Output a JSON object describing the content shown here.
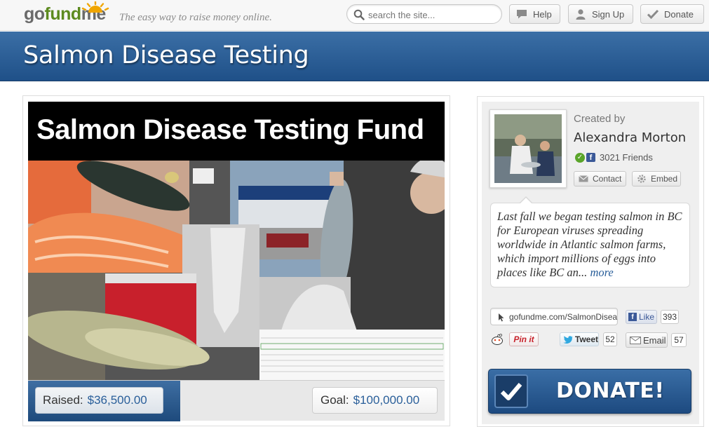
{
  "header": {
    "logo_text": "gofundme",
    "tagline": "The easy way to raise money online.",
    "search_placeholder": "search the site...",
    "help_label": "Help",
    "signup_label": "Sign Up",
    "donate_label": "Donate"
  },
  "campaign": {
    "title": "Salmon Disease Testing",
    "photo_title": "Salmon Disease Testing Fund",
    "raised_label": "Raised:",
    "raised_amount": "$36,500.00",
    "goal_label": "Goal:",
    "goal_amount": "$100,000.00",
    "progress_fraction": 0.365
  },
  "creator": {
    "created_by_label": "Created by",
    "name": "Alexandra Morton",
    "friends": "3021 Friends",
    "contact_label": "Contact",
    "embed_label": "Embed"
  },
  "description": {
    "text": "Last fall we began testing salmon in BC for European viruses spreading worldwide in Atlantic salmon farms, which import millions of eggs into places like BC an...",
    "more_label": "more"
  },
  "share": {
    "url": "gofundme.com/SalmonDisease",
    "like_label": "Like",
    "like_count": "393",
    "pinit_label": "Pin it",
    "tweet_label": "Tweet",
    "tweet_count": "52",
    "email_label": "Email",
    "email_count": "57"
  },
  "donate_button_label": "DONATE!",
  "colors": {
    "banner_blue": "#2a5d96",
    "logo_green": "#5c8a1f",
    "link_blue": "#2a5f9a"
  }
}
